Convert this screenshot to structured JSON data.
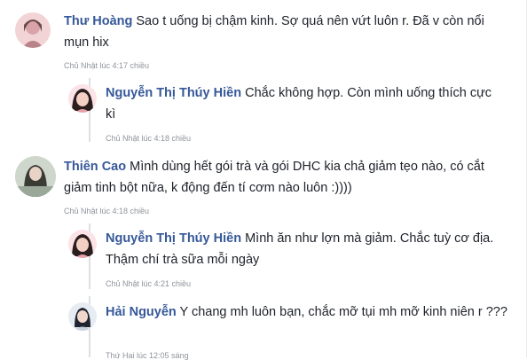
{
  "comments": [
    {
      "author": "Thư Hoàng",
      "body": "Sao t uống bị chậm kinh. Sợ quá nên vứt luôn r. Đã v còn nổi mụn hix",
      "time": "Chủ Nhật lúc 4:17 chiều",
      "avatar_icon": "avatar-photo-icon",
      "avatar_colors": [
        "#f3d4d6",
        "#d9a4a8",
        "#6b4a4a"
      ]
    },
    {
      "author": "Nguyễn Thị Thúy Hiền",
      "body": "Chắc không hợp. Còn mình uống thích cực kì",
      "time": "Chủ Nhật lúc 4:18 chiều",
      "avatar_icon": "avatar-photo-icon",
      "avatar_colors": [
        "#fbe3e8",
        "#2b1e1e",
        "#e7a0a8"
      ]
    },
    {
      "author": "Thiên Cao",
      "body": "Mình dùng hết gói trà và gói DHC kia chả giảm tẹo nào, có cắt giảm tinh bột nữa, k động đến tí cơm nào luôn :))))",
      "time": "Chủ Nhật lúc 4:18 chiều",
      "avatar_icon": "avatar-photo-icon",
      "avatar_colors": [
        "#cfd6cc",
        "#3b3b36",
        "#9aa89a"
      ]
    },
    {
      "author": "Nguyễn Thị Thúy Hiền",
      "body": "Mình ăn như lợn mà giảm. Chắc tuỳ cơ địa. Thậm chí trà sữa mỗi ngày",
      "time": "Chủ Nhật lúc 4:21 chiều",
      "avatar_icon": "avatar-photo-icon",
      "avatar_colors": [
        "#fbe3e8",
        "#2b1e1e",
        "#e7a0a8"
      ]
    },
    {
      "author": "Hải Nguyễn",
      "body": "Y chang mh luôn bạn, chắc mỡ tụi mh mỡ kinh niên r ???",
      "time": "Thứ Hai lúc 12:05 sáng",
      "avatar_icon": "avatar-photo-icon",
      "avatar_colors": [
        "#e6ecf2",
        "#1f2430",
        "#c9d2dc"
      ]
    }
  ]
}
